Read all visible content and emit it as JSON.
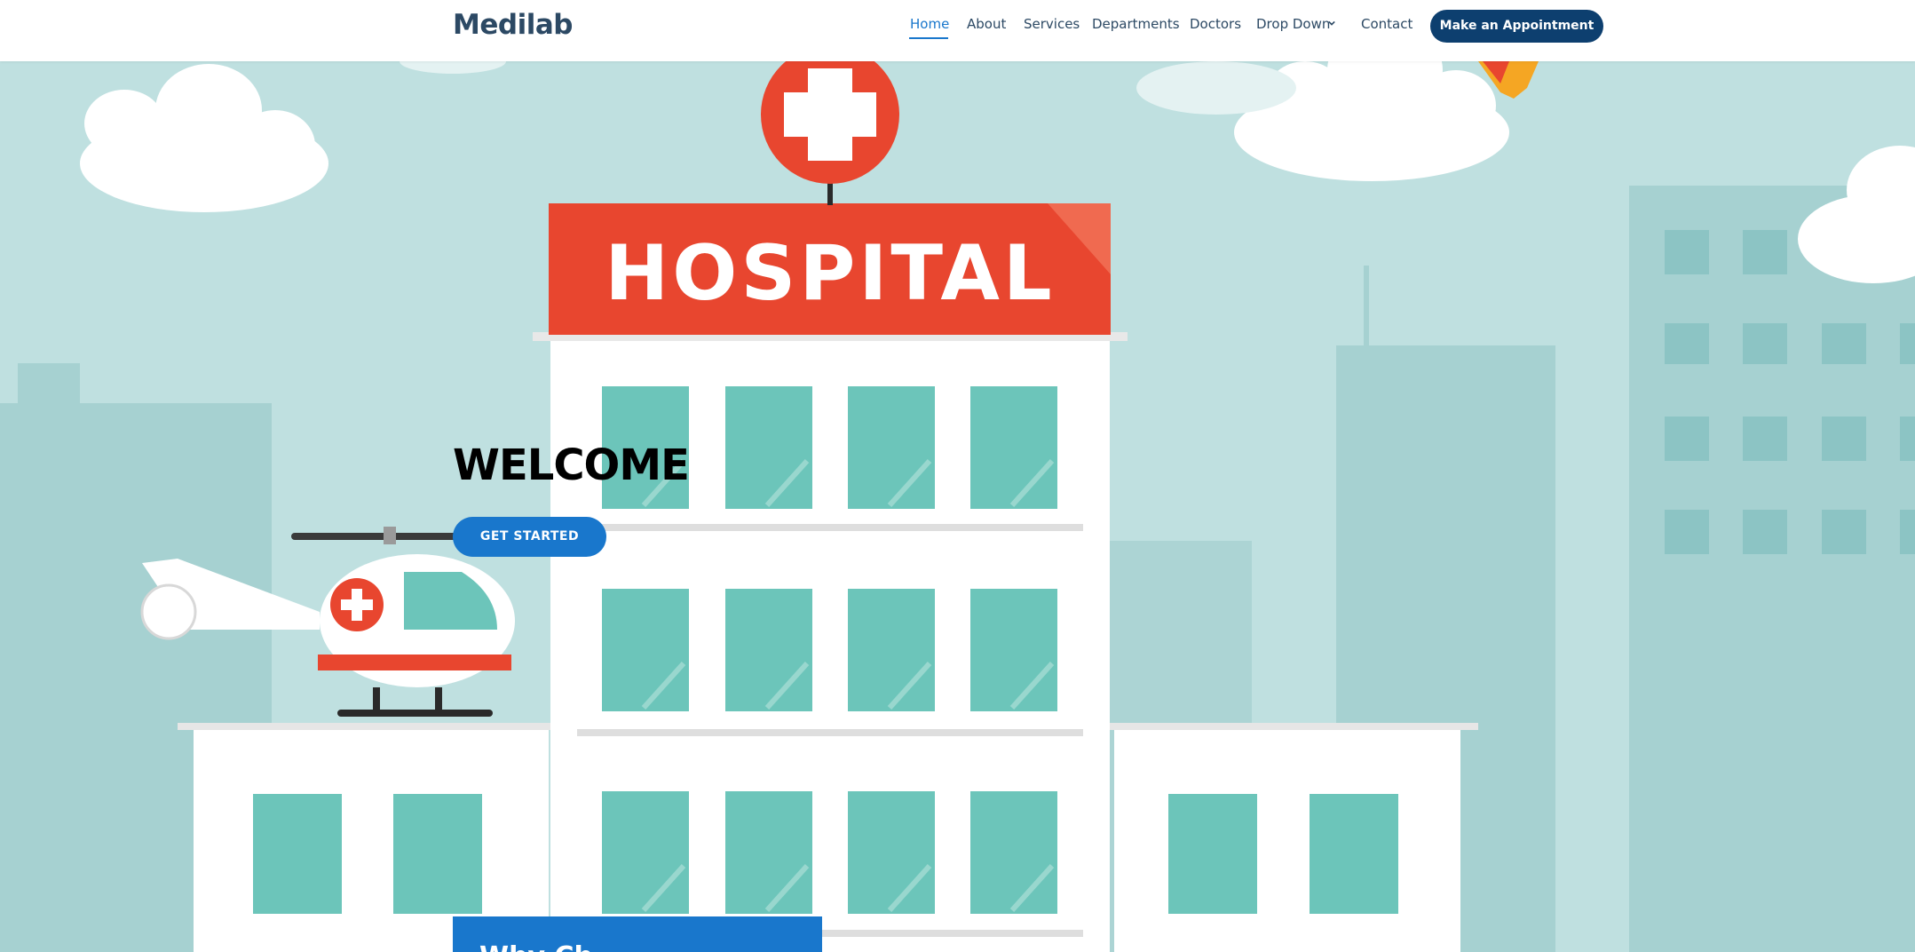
{
  "header": {
    "logo": "Medilab",
    "nav": [
      {
        "label": "Home",
        "active": true
      },
      {
        "label": "About"
      },
      {
        "label": "Services"
      },
      {
        "label": "Departments"
      },
      {
        "label": "Doctors"
      },
      {
        "label": "Drop Down"
      },
      {
        "label": "Contact"
      }
    ],
    "cta_label": "Make an Appointment"
  },
  "hero": {
    "heading": "WELCOME",
    "button_label": "GET STARTED",
    "sign_text": "HOSPITAL"
  },
  "section": {
    "title_partial": "Why Ch"
  },
  "colors": {
    "primary": "#1977cc",
    "navy": "#2c4964",
    "cta_bg": "#0d3f6f",
    "sky": "#bfe0e0",
    "sign_red": "#e8462f"
  },
  "icons": [
    "chevron-down-icon",
    "red-cross-icon",
    "helicopter-icon",
    "hospital-building-icon"
  ]
}
